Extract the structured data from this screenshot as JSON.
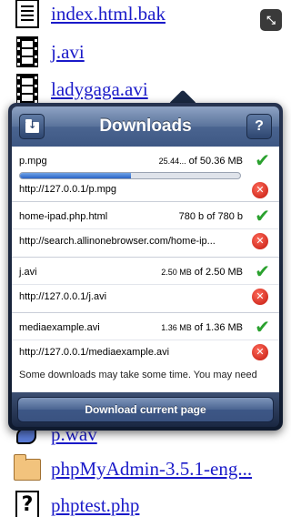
{
  "fullscreen_glyph": "⤡",
  "files": [
    {
      "icon": "text-file-icon",
      "name": "index.html.bak"
    },
    {
      "icon": "video-file-icon",
      "name": "j.avi"
    },
    {
      "icon": "video-file-icon",
      "name": "ladygaga.avi"
    },
    {
      "icon": "audio-file-icon",
      "name": "p.wav"
    },
    {
      "icon": "folder-icon",
      "name": "phpMyAdmin-3.5.1-eng..."
    },
    {
      "icon": "unknown-file-icon",
      "name": "phptest.php"
    }
  ],
  "popover": {
    "title": "Downloads",
    "help_label": "?",
    "items": [
      {
        "name": "p.mpg",
        "done_size": "25.44...",
        "of_label": "of",
        "total_size": "50.36 MB",
        "url": "http://127.0.0.1/p.mpg",
        "progress_fraction": 0.505,
        "status": "check-icon"
      },
      {
        "name": "home-ipad.php.html",
        "done_size": "780 b",
        "of_label": "of",
        "total_size": "780 b",
        "url": "http://search.allinonebrowser.com/home-ip...",
        "status": "check-icon"
      },
      {
        "name": "j.avi",
        "done_size": "2.50 MB",
        "of_label": "of",
        "total_size": "2.50 MB",
        "url": "http://127.0.0.1/j.avi",
        "status": "check-icon"
      },
      {
        "name": "mediaexample.avi",
        "done_size": "1.36 MB",
        "of_label": "of",
        "total_size": "1.36 MB",
        "url": "http://127.0.0.1/mediaexample.avi",
        "status": "check-icon"
      }
    ],
    "check_glyph": "✔",
    "remove_glyph": "✕",
    "note": "Some downloads may take some time. You may need",
    "download_page_label": "Download current page"
  },
  "colors": {
    "link": "#1a1ac9",
    "header": "#4a6490",
    "progress": "#2a63c4",
    "check": "#2aa12e",
    "remove": "#c1170c"
  }
}
